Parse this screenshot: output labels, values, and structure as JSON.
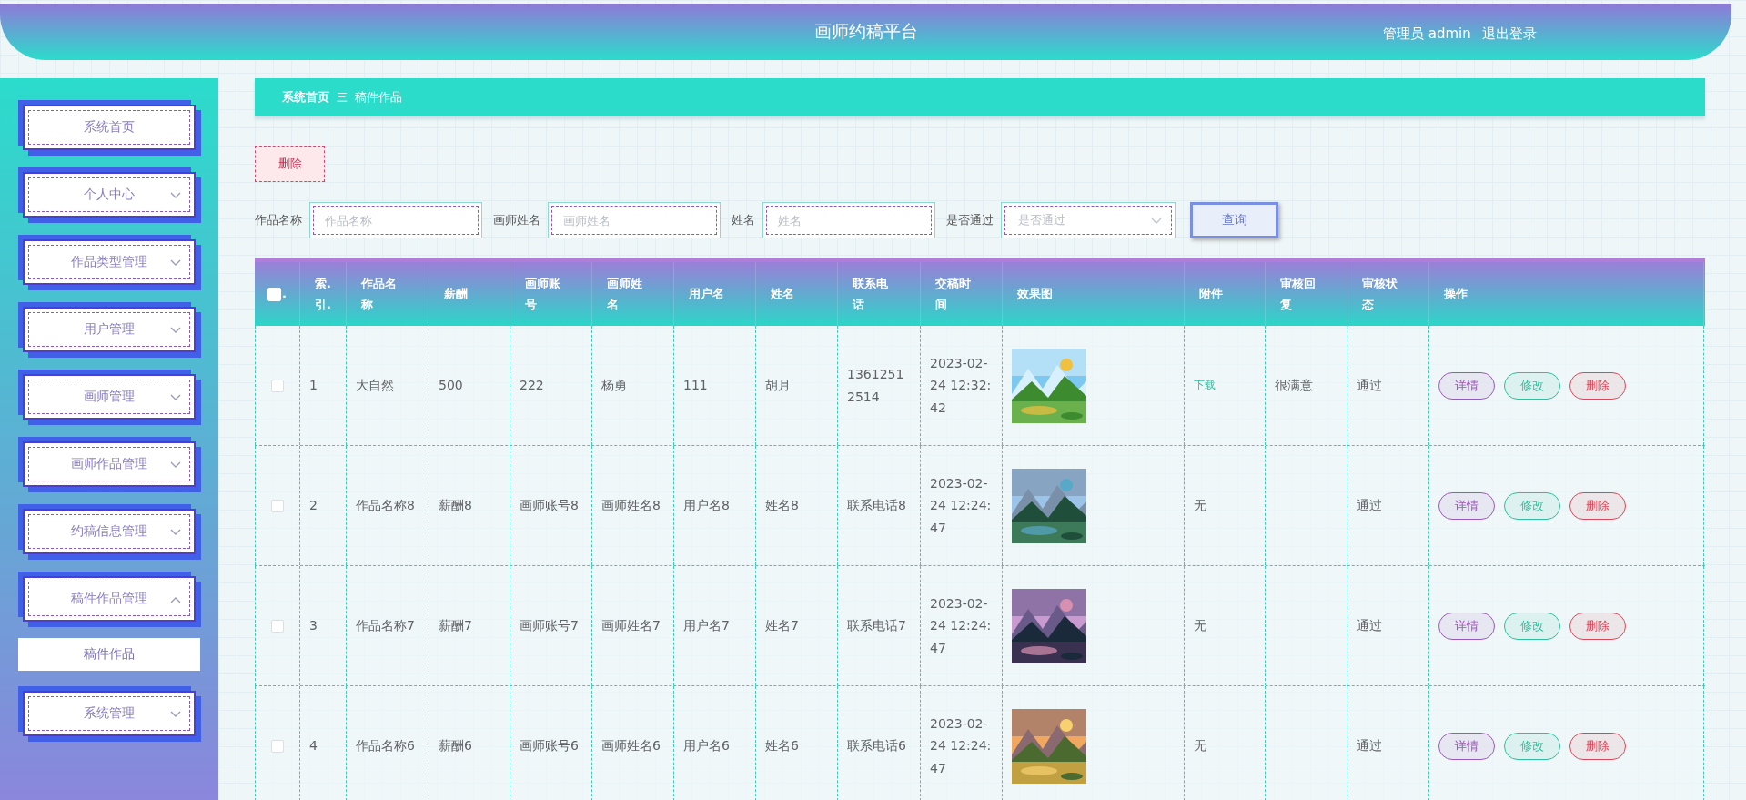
{
  "header": {
    "title": "画师约稿平台",
    "user": "管理员 admin",
    "logout": "退出登录"
  },
  "sidebar": {
    "items": [
      {
        "label": "系统首页",
        "kind": "single",
        "selected": false
      },
      {
        "label": "个人中心",
        "kind": "group",
        "expanded": false
      },
      {
        "label": "作品类型管理",
        "kind": "group",
        "expanded": false
      },
      {
        "label": "用户管理",
        "kind": "group",
        "expanded": false
      },
      {
        "label": "画师管理",
        "kind": "group",
        "expanded": false
      },
      {
        "label": "画师作品管理",
        "kind": "group",
        "expanded": false
      },
      {
        "label": "约稿信息管理",
        "kind": "group",
        "expanded": false
      },
      {
        "label": "稿件作品管理",
        "kind": "group",
        "expanded": true,
        "children": [
          {
            "label": "稿件作品",
            "selected": true
          }
        ]
      },
      {
        "label": "系统管理",
        "kind": "group",
        "expanded": false
      }
    ]
  },
  "breadcrumb": {
    "items": [
      "系统首页",
      "稿件作品"
    ],
    "separator": "三"
  },
  "toolbar": {
    "delete": "删除"
  },
  "search": {
    "fields": [
      {
        "label": "作品名称",
        "placeholder": "作品名称",
        "kind": "input"
      },
      {
        "label": "画师姓名",
        "placeholder": "画师姓名",
        "kind": "input"
      },
      {
        "label": "姓名",
        "placeholder": "姓名",
        "kind": "input"
      },
      {
        "label": "是否通过",
        "placeholder": "是否通过",
        "kind": "select"
      }
    ],
    "button": "查询"
  },
  "table": {
    "select_all": {
      "checked": false,
      "mark": "."
    },
    "columns": [
      "索.引.",
      "作品名称",
      "薪酬",
      "画师账号",
      "画师姓名",
      "用户名",
      "姓名",
      "联系电话",
      "交稿时间",
      "效果图",
      "附件",
      "审核回复",
      "审核状态",
      "操作"
    ],
    "rows": [
      {
        "checked": false,
        "cells": [
          "1",
          "大自然",
          "500",
          "222",
          "杨勇",
          "111",
          "胡月",
          "13612512514",
          "2023-02-24 12:32:42"
        ],
        "picture": {
          "kind": "picture"
        },
        "attachment": {
          "text": "下载",
          "kind": "link"
        },
        "reply": "很满意",
        "status": "通过",
        "actions": [
          {
            "label": "详情",
            "color": "#9b59b6"
          },
          {
            "label": "修改",
            "color": "#2fbf9c"
          },
          {
            "label": "删除",
            "color": "#d9485a"
          }
        ]
      },
      {
        "checked": false,
        "cells": [
          "2",
          "作品名称8",
          "薪酬8",
          "画师账号8",
          "画师姓名8",
          "用户名8",
          "姓名8",
          "联系电话8",
          "2023-02-24 12:24:47"
        ],
        "picture": {
          "kind": "picture"
        },
        "attachment": {
          "text": "无",
          "kind": "plain"
        },
        "status": "通过",
        "actions": [
          {
            "label": "详情",
            "color": "#9b59b6"
          },
          {
            "label": "修改",
            "color": "#2fbf9c"
          },
          {
            "label": "删除",
            "color": "#d9485a"
          }
        ]
      },
      {
        "checked": false,
        "cells": [
          "3",
          "作品名称7",
          "薪酬7",
          "画师账号7",
          "画师姓名7",
          "用户名7",
          "姓名7",
          "联系电话7",
          "2023-02-24 12:24:47"
        ],
        "picture": {
          "kind": "picture"
        },
        "attachment": {
          "text": "无",
          "kind": "plain"
        },
        "status": "通过",
        "actions": [
          {
            "label": "详情",
            "color": "#9b59b6"
          },
          {
            "label": "修改",
            "color": "#2fbf9c"
          },
          {
            "label": "删除",
            "color": "#d9485a"
          }
        ]
      },
      {
        "checked": false,
        "cells": [
          "4",
          "作品名称6",
          "薪酬6",
          "画师账号6",
          "画师姓名6",
          "用户名6",
          "姓名6",
          "联系电话6",
          "2023-02-24 12:24:47"
        ],
        "picture": {
          "kind": "picture"
        },
        "attachment": {
          "text": "无",
          "kind": "plain"
        },
        "status": "通过",
        "actions": [
          {
            "label": "详情",
            "color": "#9b59b6"
          },
          {
            "label": "修改",
            "color": "#2fbf9c"
          },
          {
            "label": "删除",
            "color": "#d9485a"
          }
        ]
      }
    ]
  }
}
